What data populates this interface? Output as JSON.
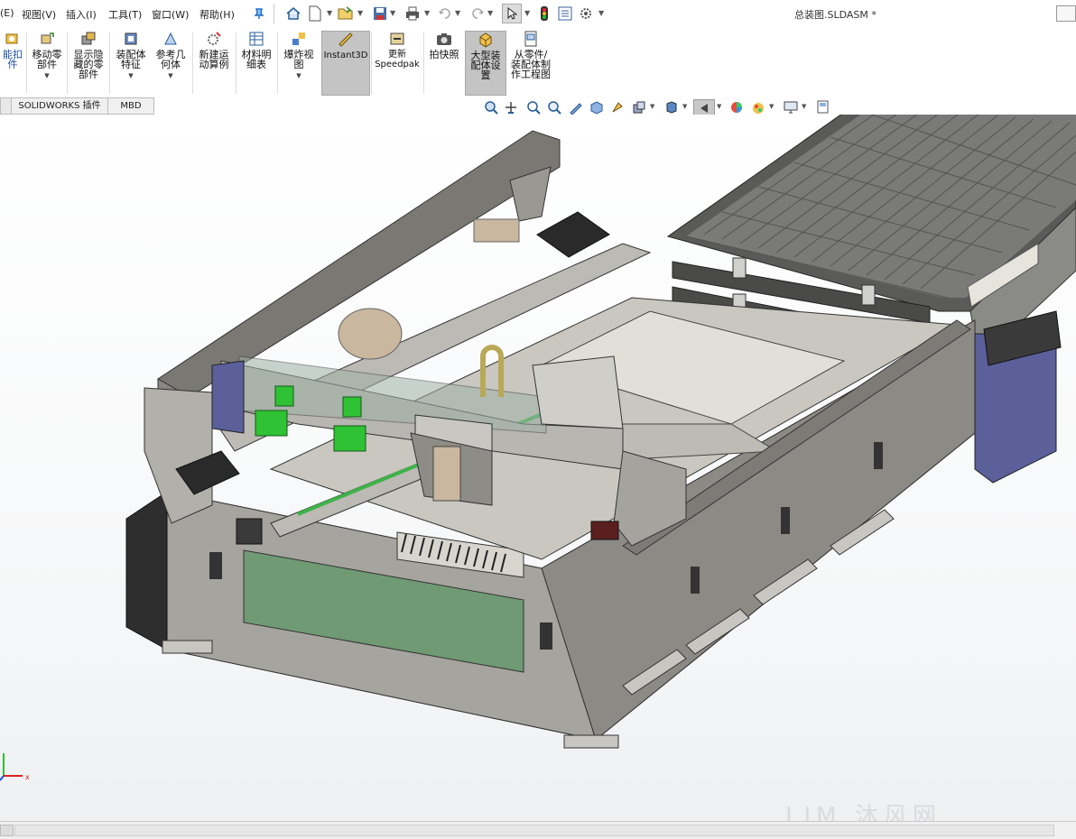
{
  "menu": {
    "items": [
      "(E)",
      "视图(V)",
      "插入(I)",
      "工具(T)",
      "窗口(W)",
      "帮助(H)"
    ]
  },
  "document": {
    "title": "总装图.SLDASM *"
  },
  "quick_access": {
    "icons": [
      "home-icon",
      "new-doc-icon",
      "open-icon",
      "save-icon",
      "print-icon",
      "undo-icon",
      "redo-icon",
      "select-icon",
      "rebuild-icon",
      "file-properties-icon",
      "options-icon"
    ]
  },
  "ribbon": {
    "buttons": [
      {
        "label": "能扣\n件"
      },
      {
        "label": "移动零\n部件"
      },
      {
        "label": "显示隐\n藏的零\n部件"
      },
      {
        "label": "装配体\n特征"
      },
      {
        "label": "参考几\n何体"
      },
      {
        "label": "新建运\n动算例"
      },
      {
        "label": "材料明\n细表"
      },
      {
        "label": "爆炸视\n图"
      },
      {
        "label": "Instant3D"
      },
      {
        "label": "更新\nSpeedpak"
      },
      {
        "label": "拍快照"
      },
      {
        "label": "大型装\n配体设\n置"
      },
      {
        "label": "从零件/\n装配体制\n作工程图"
      }
    ]
  },
  "tabs": [
    "SOLIDWORKS 插件",
    "MBD"
  ],
  "heads_up": {
    "icons": [
      "zoom-fit-icon",
      "zoom-area-icon",
      "previous-view-icon",
      "section-view-icon",
      "dynamic-annotation-icon",
      "view-orientation-icon",
      "display-style-icon",
      "hide-show-icon",
      "edit-appearance-icon",
      "apply-scene-icon",
      "view-settings-icon",
      "display-manager-icon"
    ]
  },
  "watermark": {
    "text": "LIM 沐风网"
  },
  "colors": {
    "frame": "#9a9892",
    "frame_dark": "#6f6d68",
    "gantry": "#b8b6b0",
    "green_block": "#2fc234",
    "panel_green": "#6f9a74",
    "bed_grid": "#6c6c6c",
    "blue_box": "#5b5f9a",
    "tan": "#c9b79f",
    "olive_hook": "#b9a957",
    "accent_active": "#c4c4c4"
  }
}
